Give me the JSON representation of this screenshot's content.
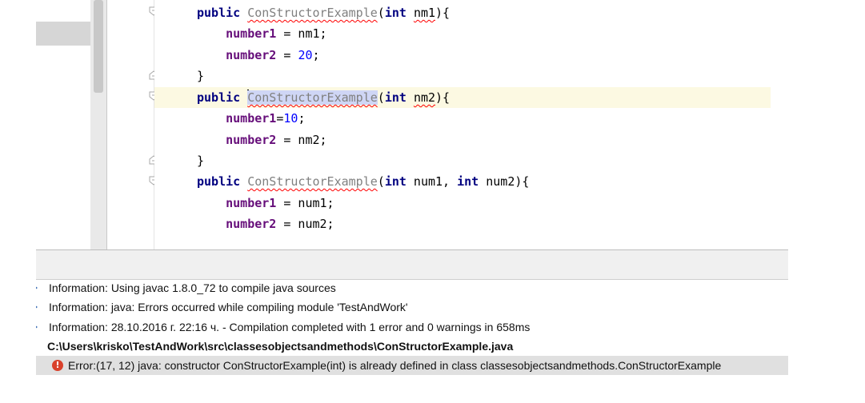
{
  "editor": {
    "lines": [
      {
        "indent": "",
        "parts": [
          {
            "t": "public",
            "c": "kw"
          },
          {
            "t": " "
          },
          {
            "t": "ConStructorExample",
            "c": "ctor"
          },
          {
            "t": "("
          },
          {
            "t": "int",
            "c": "kw"
          },
          {
            "t": " "
          },
          {
            "t": "nm1",
            "c": "err"
          },
          {
            "t": "){"
          }
        ]
      },
      {
        "indent": "    ",
        "parts": [
          {
            "t": "number1",
            "c": "fld"
          },
          {
            "t": " = nm1;"
          }
        ]
      },
      {
        "indent": "    ",
        "parts": [
          {
            "t": "number2",
            "c": "fld"
          },
          {
            "t": " = "
          },
          {
            "t": "20",
            "c": "num"
          },
          {
            "t": ";"
          }
        ]
      },
      {
        "indent": "",
        "parts": [
          {
            "t": "}"
          }
        ]
      },
      {
        "indent": "",
        "caret": true,
        "parts": [
          {
            "t": "public",
            "c": "kw"
          },
          {
            "t": " "
          },
          {
            "t": "|CARET|"
          },
          {
            "t": "ConStructorExample",
            "c": "ctor hl"
          },
          {
            "t": "("
          },
          {
            "t": "int",
            "c": "kw"
          },
          {
            "t": " "
          },
          {
            "t": "nm2",
            "c": "err"
          },
          {
            "t": "){"
          }
        ]
      },
      {
        "indent": "    ",
        "parts": [
          {
            "t": "number1",
            "c": "fld"
          },
          {
            "t": "="
          },
          {
            "t": "10",
            "c": "num"
          },
          {
            "t": ";"
          }
        ]
      },
      {
        "indent": "    ",
        "parts": [
          {
            "t": "number2",
            "c": "fld"
          },
          {
            "t": " = nm2;"
          }
        ]
      },
      {
        "indent": "",
        "parts": [
          {
            "t": "}"
          }
        ]
      },
      {
        "indent": "",
        "parts": [
          {
            "t": "public",
            "c": "kw"
          },
          {
            "t": " "
          },
          {
            "t": "ConStructorExample",
            "c": "ctor"
          },
          {
            "t": "("
          },
          {
            "t": "int",
            "c": "kw"
          },
          {
            "t": " num1, "
          },
          {
            "t": "int",
            "c": "kw"
          },
          {
            "t": " num2){"
          }
        ]
      },
      {
        "indent": "    ",
        "parts": [
          {
            "t": "number1",
            "c": "fld"
          },
          {
            "t": " = num1;"
          }
        ]
      },
      {
        "indent": "    ",
        "parts": [
          {
            "t": "number2",
            "c": "fld"
          },
          {
            "t": " = num2;"
          }
        ]
      }
    ]
  },
  "messages": {
    "info1": "Information: Using javac 1.8.0_72 to compile java sources",
    "info2": "Information: java: Errors occurred while compiling module 'TestAndWork'",
    "info3": "Information: 28.10.2016 г. 22:16 ч. - Compilation completed with 1 error and 0 warnings in 658ms",
    "file_path": "C:\\Users\\krisko\\TestAndWork\\src\\classesobjectsandmethods\\ConStructorExample.java",
    "error": "Error:(17, 12)  java: constructor ConStructorExample(int) is already defined in class classesobjectsandmethods.ConStructorExample"
  },
  "colors": {
    "keyword": "#000080",
    "field": "#660e7a",
    "number": "#0000ff",
    "error_underline": "#ff0000",
    "caret_row": "#fcf9e2",
    "error_icon": "#d9412b"
  }
}
